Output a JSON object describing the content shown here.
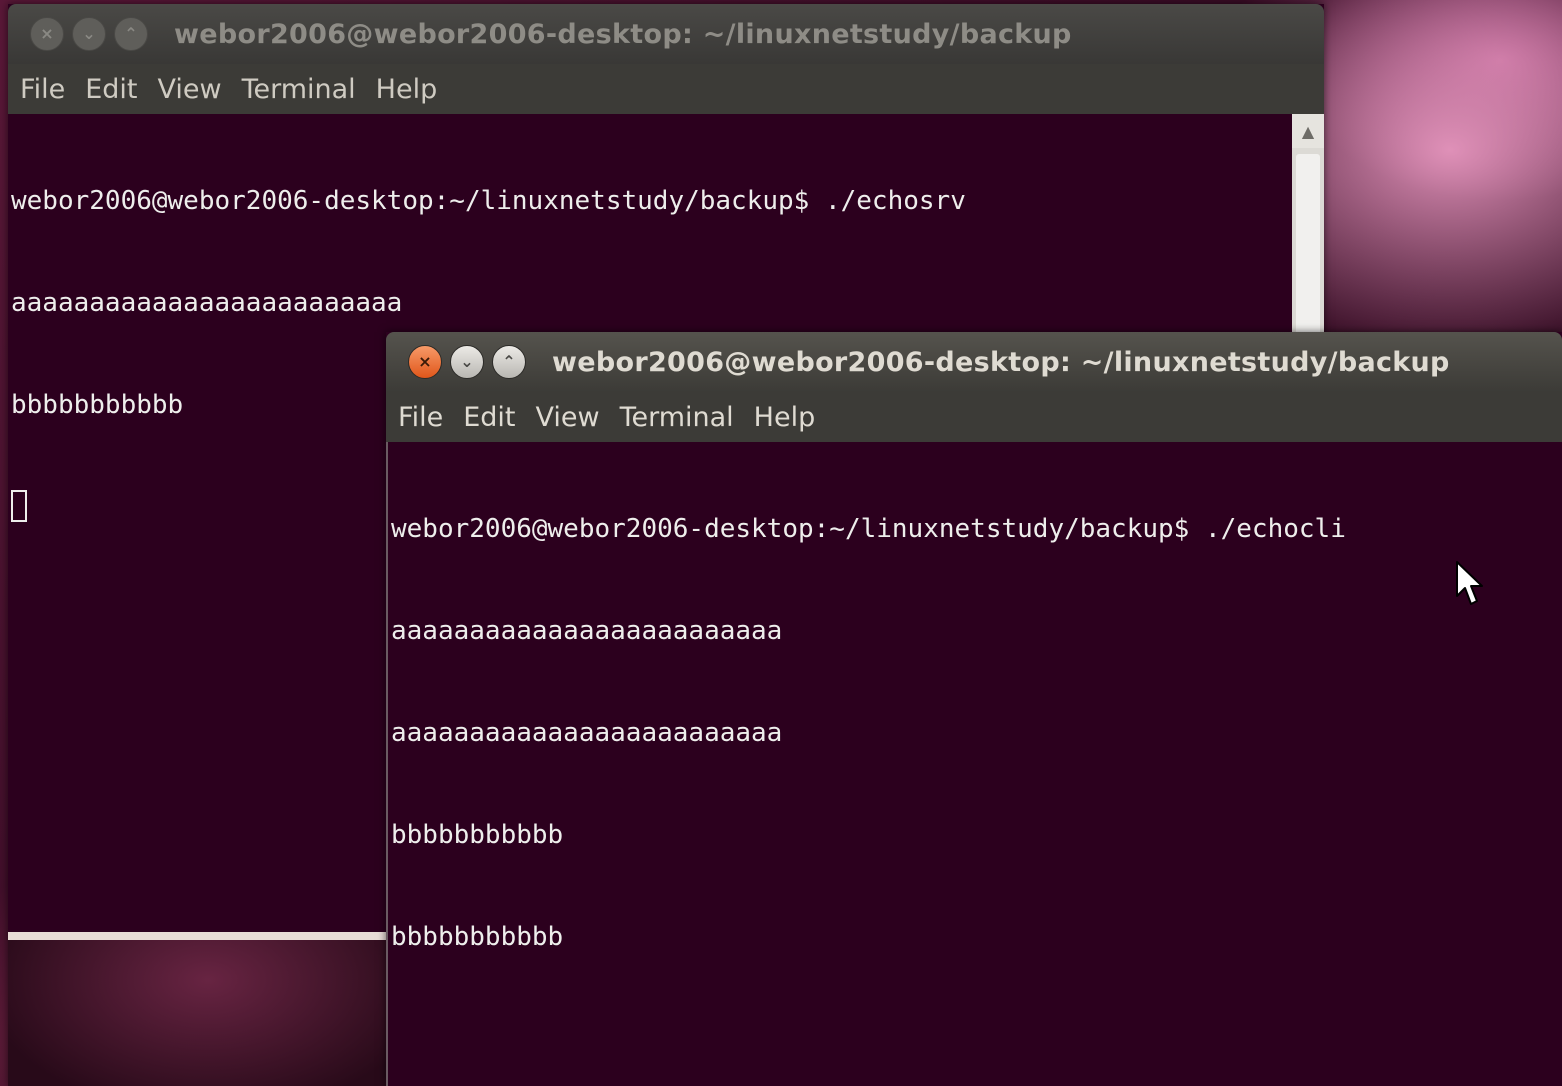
{
  "back_window": {
    "title": "webor2006@webor2006-desktop: ~/linuxnetstudy/backup",
    "controls": {
      "close": "×",
      "minimize": "⌄",
      "maximize": "⌃"
    },
    "menu": [
      "File",
      "Edit",
      "View",
      "Terminal",
      "Help"
    ],
    "lines": [
      "webor2006@webor2006-desktop:~/linuxnetstudy/backup$ ./echosrv",
      "aaaaaaaaaaaaaaaaaaaaaaaaa",
      "bbbbbbbbbbb"
    ],
    "scroll_up_symbol": "▲"
  },
  "front_window": {
    "title": "webor2006@webor2006-desktop: ~/linuxnetstudy/backup",
    "controls": {
      "close": "×",
      "minimize": "⌄",
      "maximize": "⌃"
    },
    "menu": [
      "File",
      "Edit",
      "View",
      "Terminal",
      "Help"
    ],
    "lines": [
      "webor2006@webor2006-desktop:~/linuxnetstudy/backup$ ./echocli",
      "aaaaaaaaaaaaaaaaaaaaaaaaa",
      "aaaaaaaaaaaaaaaaaaaaaaaaa",
      "bbbbbbbbbbb",
      "bbbbbbbbbbb"
    ]
  },
  "icons": {
    "pointer": "mouse-pointer-icon"
  }
}
